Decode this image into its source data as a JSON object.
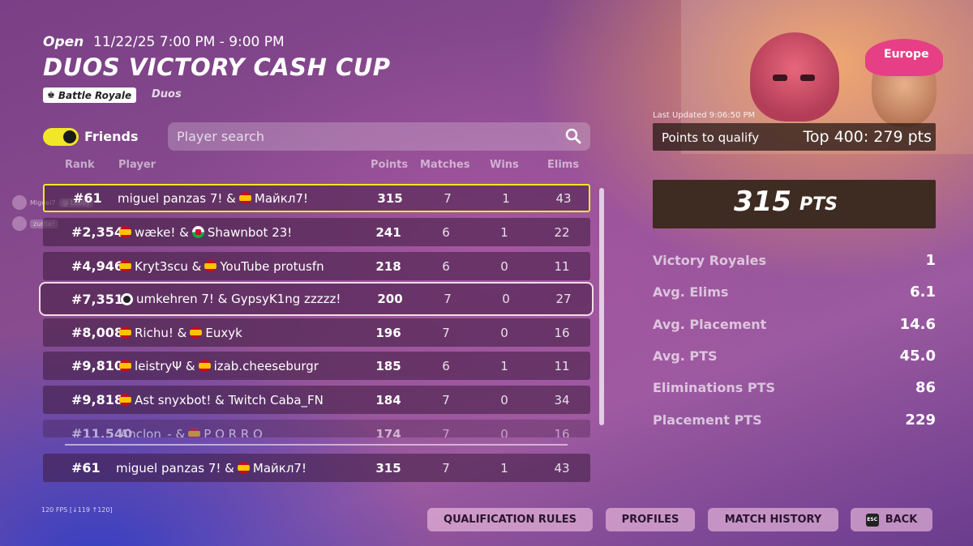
{
  "header": {
    "status": "Open",
    "date_range": "11/22/25 7:00 PM - 9:00 PM",
    "title": "DUOS VICTORY CASH CUP",
    "mode": "Battle Royale",
    "team_type": "Duos"
  },
  "filters": {
    "friends_label": "Friends",
    "friends_toggle_on": true,
    "search_placeholder": "Player search"
  },
  "table": {
    "columns": [
      "Rank",
      "Player",
      "Points",
      "Matches",
      "Wins",
      "Elims"
    ],
    "rows": [
      {
        "rank": "#61",
        "player_a": "miguel panzas 7! &",
        "flag_b": "es",
        "player_b": "Майкл7!",
        "points": "315",
        "matches": "7",
        "wins": "1",
        "elims": "43"
      },
      {
        "rank": "#2,354",
        "flag_a": "es",
        "player_a": "wæke! &",
        "flag_b": "wales",
        "player_b": "Shawnbot 23!",
        "points": "241",
        "matches": "6",
        "wins": "1",
        "elims": "22"
      },
      {
        "rank": "#4,946",
        "flag_a": "es",
        "player_a": "Kryt3scu &",
        "flag_b": "es",
        "player_b": "YouTube protusfn",
        "points": "218",
        "matches": "6",
        "wins": "0",
        "elims": "11"
      },
      {
        "rank": "#7,351",
        "flag_a": "other",
        "player_a": "umkehren 7! & GypsyK1ng zzzzz!",
        "points": "200",
        "matches": "7",
        "wins": "0",
        "elims": "27"
      },
      {
        "rank": "#8,008",
        "flag_a": "es",
        "player_a": "Richu! &",
        "flag_b": "es",
        "player_b": "Euxyk",
        "points": "196",
        "matches": "7",
        "wins": "0",
        "elims": "16"
      },
      {
        "rank": "#9,810",
        "flag_a": "es",
        "player_a": "leistryΨ &",
        "flag_b": "es",
        "player_b": "izab.cheeseburgr",
        "points": "185",
        "matches": "6",
        "wins": "1",
        "elims": "11"
      },
      {
        "rank": "#9,818",
        "flag_a": "es",
        "player_a": "Ast snyxbot! & Twitch Caba_FN",
        "points": "184",
        "matches": "7",
        "wins": "0",
        "elims": "34"
      },
      {
        "rank": "#11,540",
        "player_a": "Anclon_- &",
        "flag_b": "es",
        "player_b": "P O R R O",
        "points": "174",
        "matches": "7",
        "wins": "0",
        "elims": "16"
      }
    ],
    "pinned_row": {
      "rank": "#61",
      "player_a": "miguel panzas 7! &",
      "player_b": "Майкл7!",
      "points": "315",
      "matches": "7",
      "wins": "1",
      "elims": "43"
    }
  },
  "friend_chips": [
    {
      "name": "Miguel7",
      "tag": "@ Lobby"
    },
    {
      "name": "zurita!"
    }
  ],
  "sidebar": {
    "region": "Europe",
    "last_updated": "Last Updated 9:06:50 PM",
    "qualify_label": "Points to qualify",
    "qualify_value": "Top 400: 279 pts",
    "total_points": "315",
    "total_points_unit": "PTS",
    "stats": [
      {
        "label": "Victory Royales",
        "value": "1"
      },
      {
        "label": "Avg. Elims",
        "value": "6.1"
      },
      {
        "label": "Avg. Placement",
        "value": "14.6"
      },
      {
        "label": "Avg. PTS",
        "value": "45.0"
      },
      {
        "label": "Eliminations PTS",
        "value": "86"
      },
      {
        "label": "Placement PTS",
        "value": "229"
      }
    ]
  },
  "footer": {
    "fps": "120 FPS [↓119 ↑120]",
    "buttons": [
      "QUALIFICATION RULES",
      "PROFILES",
      "MATCH HISTORY",
      "BACK"
    ],
    "back_key": "ESC"
  },
  "colors": {
    "highlight_self": "#f1e62a",
    "highlight_focus": "#f6dbe8",
    "toggle_on": "#f1e62a"
  }
}
